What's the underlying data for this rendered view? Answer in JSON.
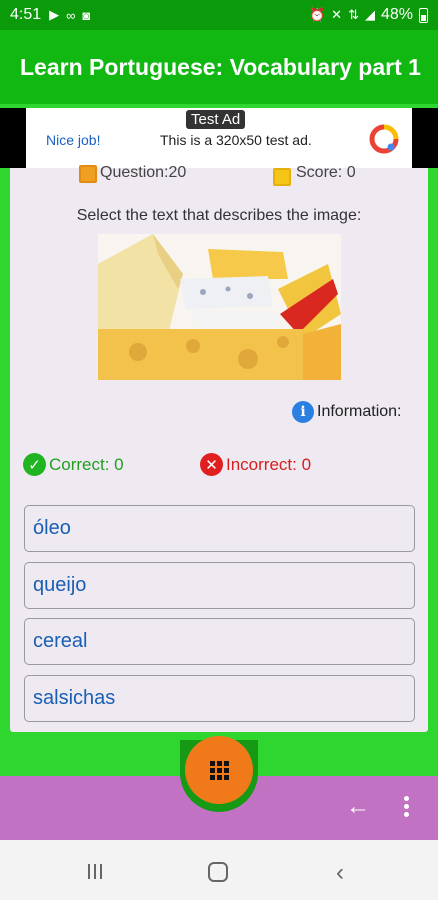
{
  "status_bar": {
    "time": "4:51",
    "battery": "48%",
    "left_icons": [
      "play-store-icon",
      "voicemail-icon",
      "media-icon"
    ],
    "right_icons": [
      "alarm-icon",
      "mute-icon",
      "4g-icon",
      "signal-icon",
      "battery-icon"
    ]
  },
  "app_bar": {
    "title": "Learn Portuguese: Vocabulary part 1"
  },
  "ad": {
    "badge": "Test Ad",
    "left_text": "Nice job!",
    "body_text": "This is a 320x50 test ad.",
    "logo_icon": "admob-logo-icon"
  },
  "quiz": {
    "question_label": "Question:20",
    "score_label": "Score: 0",
    "instruction": "Select the text that describes the image:",
    "image_icon": "cheese-image",
    "info_label": "Information:",
    "correct_label": "Correct: 0",
    "incorrect_label": "Incorrect: 0",
    "options": [
      "óleo",
      "queijo",
      "cereal",
      "salsichas"
    ]
  },
  "bottom_nav": {
    "fab_icon": "grid-icon",
    "back_icon": "arrow-left-icon",
    "more_icon": "more-vertical-icon"
  },
  "system_nav": [
    "recent-apps-icon",
    "home-icon",
    "back-icon"
  ],
  "colors": {
    "status_bar": "#0a9a0a",
    "app_bar": "#12b812",
    "background_green": "#2fd62f",
    "card": "#efe9f2",
    "option_text": "#1a5fb4",
    "correct": "#1fa11f",
    "incorrect": "#d62020",
    "fab": "#f07a1a",
    "bottom_bar": "#c172c2"
  }
}
